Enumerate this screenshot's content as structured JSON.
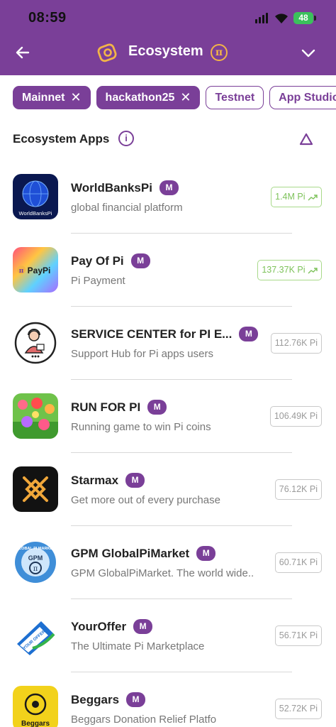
{
  "status": {
    "time": "08:59",
    "battery": "48"
  },
  "header": {
    "title": "Ecosystem",
    "pi_symbol": "π"
  },
  "chips": [
    {
      "label": "Mainnet",
      "active": true
    },
    {
      "label": "hackathon25",
      "active": true
    },
    {
      "label": "Testnet",
      "active": false
    },
    {
      "label": "App Studio",
      "active": false
    }
  ],
  "section": {
    "title": "Ecosystem Apps",
    "info": "i"
  },
  "apps": [
    {
      "name": "WorldBanksPi",
      "badge": "M",
      "desc": "global financial platform",
      "stat": "1.4M Pi",
      "trending": true
    },
    {
      "name": "Pay Of Pi",
      "badge": "M",
      "desc": "Pi Payment",
      "stat": "137.37K Pi",
      "trending": true
    },
    {
      "name": "SERVICE CENTER for PI E...",
      "badge": "M",
      "desc": "Support Hub for Pi apps users",
      "stat": "112.76K Pi",
      "trending": false
    },
    {
      "name": "RUN FOR PI",
      "badge": "M",
      "desc": "Running game to win Pi coins",
      "stat": "106.49K Pi",
      "trending": false
    },
    {
      "name": "Starmax",
      "badge": "M",
      "desc": "Get more out of every purchase",
      "stat": "76.12K Pi",
      "trending": false
    },
    {
      "name": "GPM GlobalPiMarket",
      "badge": "M",
      "desc": "GPM GlobalPiMarket. The world wide..",
      "stat": "60.71K Pi",
      "trending": false
    },
    {
      "name": "YourOffer",
      "badge": "M",
      "desc": "The Ultimate Pi Marketplace",
      "stat": "56.71K Pi",
      "trending": false
    },
    {
      "name": "Beggars",
      "badge": "M",
      "desc": "Beggars Donation Relief Platfo",
      "stat": "52.72K Pi",
      "trending": false
    }
  ],
  "icon_text": {
    "worldbanks": "WorldBanksPi",
    "paypi": "PayPi",
    "paypi_symbol": "π",
    "gpm": "GPM",
    "gpm_ring": "GLOBAL PI MARKET",
    "youroffer": "YOUR OFFER",
    "beggars": "Beggars"
  },
  "colors": {
    "brand": "#7a3f98",
    "accent": "#f3b447",
    "trend_green": "#7dc25a"
  }
}
